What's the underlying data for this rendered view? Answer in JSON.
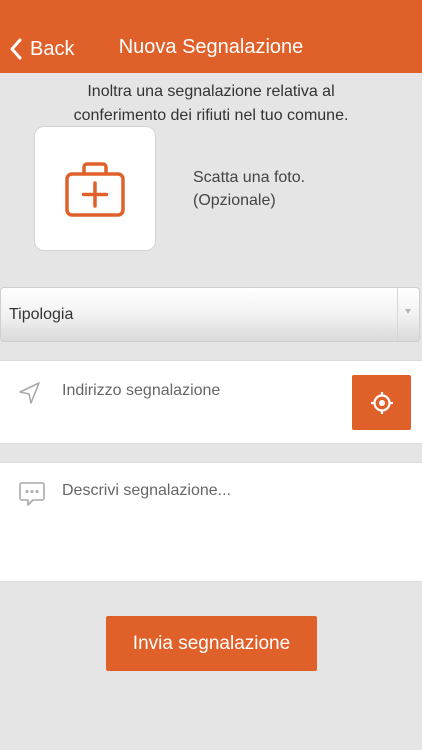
{
  "navbar": {
    "back_label": "Back",
    "title": "Nuova Segnalazione",
    "color": "#e0602a"
  },
  "intro": {
    "line1": "Inoltra una segnalazione relativa al",
    "line2": "conferimento dei rifiuti nel tuo comune."
  },
  "photo": {
    "icon": "add-photo-icon",
    "hint_line1": "Scatta una foto.",
    "hint_line2": "(Opzionale)"
  },
  "tipologia": {
    "selected": "Tipologia"
  },
  "address": {
    "icon": "navigation-arrow-icon",
    "placeholder": "Indirizzo segnalazione",
    "value": "",
    "locate_icon": "crosshair-icon"
  },
  "description": {
    "icon": "chat-bubble-icon",
    "placeholder": "Descrivi segnalazione...",
    "value": ""
  },
  "submit": {
    "label": "Invia segnalazione"
  }
}
